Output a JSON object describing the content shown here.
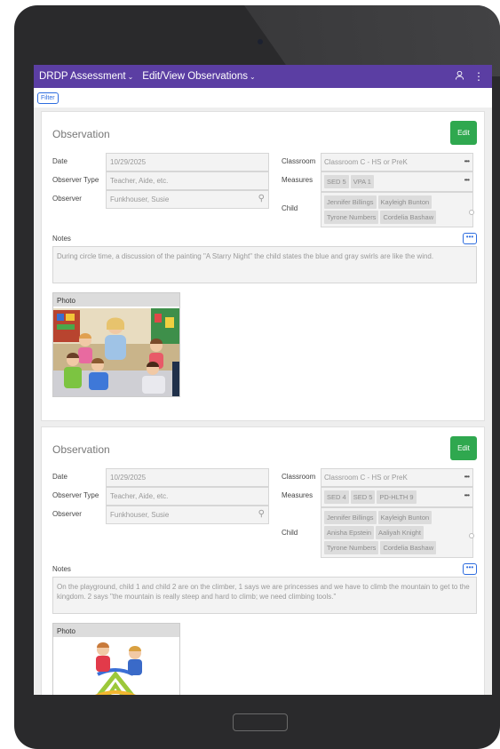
{
  "header": {
    "app_title": "DRDP Assessment",
    "page_title": "Edit/View Observations",
    "user_icon": "user-icon",
    "menu_icon": "more-vertical-icon"
  },
  "toolbar": {
    "filter_label": "Filter"
  },
  "labels": {
    "date": "Date",
    "observer_type": "Observer Type",
    "observer": "Observer",
    "classroom": "Classroom",
    "measures": "Measures",
    "child": "Child",
    "notes": "Notes",
    "photo": "Photo",
    "edit": "Edit",
    "more": "•••"
  },
  "observations": [
    {
      "title": "Observation",
      "date": "10/29/2025",
      "observer_type": "Teacher, Aide, etc.",
      "observer": "Funkhouser, Susie",
      "classroom": "Classroom C - HS or PreK",
      "measures": [
        "SED 5",
        "VPA 1"
      ],
      "children": [
        "Jennifer Billings",
        "Kayleigh Bunton",
        "Tyrone Numbers",
        "Cordelia Bashaw"
      ],
      "notes": "During circle time, a discussion of the painting \"A Starry Night\" the child states the blue and gray swirls are like the wind."
    },
    {
      "title": "Observation",
      "date": "10/29/2025",
      "observer_type": "Teacher, Aide, etc.",
      "observer": "Funkhouser, Susie",
      "classroom": "Classroom C - HS or PreK",
      "measures": [
        "SED 4",
        "SED 5",
        "PD-HLTH 9"
      ],
      "children": [
        "Jennifer Billings",
        "Kayleigh Bunton",
        "Anisha Epstein",
        "Aaliyah Knight",
        "Tyrone Numbers",
        "Cordelia Bashaw"
      ],
      "notes": "On the playground, child 1 and child 2 are on the climber, 1 says we are princesses and we have to climb the mountain to get to the kingdom. 2 says \"the mountain is really steep and hard to climb; we need climbing tools.\""
    }
  ],
  "colors": {
    "header": "#5b3ea3",
    "edit": "#2fa84f",
    "link": "#2d6cdf"
  }
}
